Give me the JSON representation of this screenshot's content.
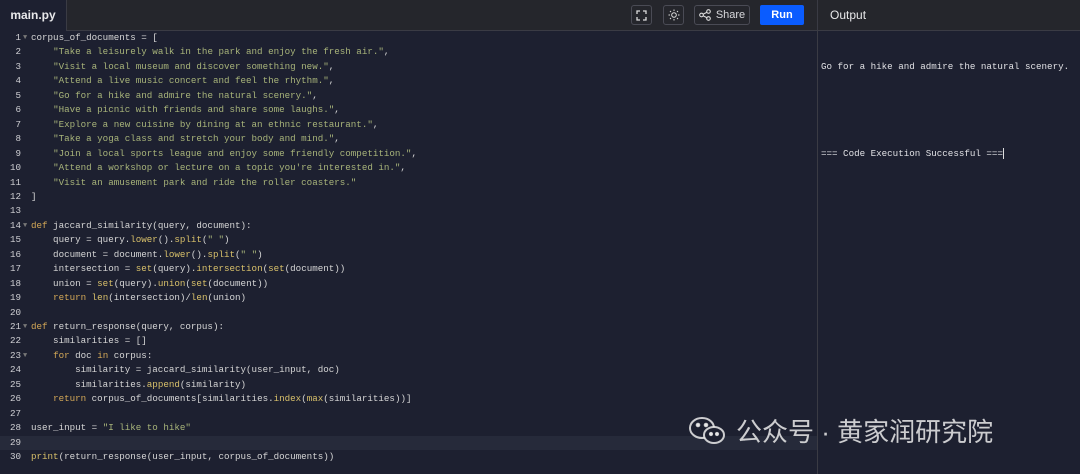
{
  "header": {
    "file_tab": "main.py",
    "share_label": "Share",
    "run_label": "Run",
    "output_title": "Output",
    "icons": [
      "fullscreen-icon",
      "theme-sun-icon",
      "share-icon"
    ]
  },
  "colors": {
    "run_button": "#0a5cff",
    "editor_bg": "#1d2030",
    "keyword": "#d4a857",
    "string": "#a8b47a"
  },
  "editor": {
    "active_line": 29,
    "fold_lines": [
      1,
      14,
      21,
      23
    ],
    "lines": [
      [
        [
          "t",
          "corpus_of_documents = ["
        ]
      ],
      [
        [
          "t",
          "    "
        ],
        [
          "str",
          "\"Take a leisurely walk in the park and enjoy the fresh air.\""
        ],
        [
          "t",
          ","
        ]
      ],
      [
        [
          "t",
          "    "
        ],
        [
          "str",
          "\"Visit a local museum and discover something new.\""
        ],
        [
          "t",
          ","
        ]
      ],
      [
        [
          "t",
          "    "
        ],
        [
          "str",
          "\"Attend a live music concert and feel the rhythm.\""
        ],
        [
          "t",
          ","
        ]
      ],
      [
        [
          "t",
          "    "
        ],
        [
          "str",
          "\"Go for a hike and admire the natural scenery.\""
        ],
        [
          "t",
          ","
        ]
      ],
      [
        [
          "t",
          "    "
        ],
        [
          "str",
          "\"Have a picnic with friends and share some laughs.\""
        ],
        [
          "t",
          ","
        ]
      ],
      [
        [
          "t",
          "    "
        ],
        [
          "str",
          "\"Explore a new cuisine by dining at an ethnic restaurant.\""
        ],
        [
          "t",
          ","
        ]
      ],
      [
        [
          "t",
          "    "
        ],
        [
          "str",
          "\"Take a yoga class and stretch your body and mind.\""
        ],
        [
          "t",
          ","
        ]
      ],
      [
        [
          "t",
          "    "
        ],
        [
          "str",
          "\"Join a local sports league and enjoy some friendly competition.\""
        ],
        [
          "t",
          ","
        ]
      ],
      [
        [
          "t",
          "    "
        ],
        [
          "str",
          "\"Attend a workshop or lecture on a topic you're interested in.\""
        ],
        [
          "t",
          ","
        ]
      ],
      [
        [
          "t",
          "    "
        ],
        [
          "str",
          "\"Visit an amusement park and ride the roller coasters.\""
        ]
      ],
      [
        [
          "t",
          "]"
        ]
      ],
      [],
      [
        [
          "kw",
          "def"
        ],
        [
          "t",
          " jaccard_similarity(query, document):"
        ]
      ],
      [
        [
          "t",
          "    query = query."
        ],
        [
          "fn",
          "lower"
        ],
        [
          "t",
          "()."
        ],
        [
          "fn",
          "split"
        ],
        [
          "t",
          "("
        ],
        [
          "str",
          "\" \""
        ],
        [
          "t",
          ")"
        ]
      ],
      [
        [
          "t",
          "    document = document."
        ],
        [
          "fn",
          "lower"
        ],
        [
          "t",
          "()."
        ],
        [
          "fn",
          "split"
        ],
        [
          "t",
          "("
        ],
        [
          "str",
          "\" \""
        ],
        [
          "t",
          ")"
        ]
      ],
      [
        [
          "t",
          "    intersection = "
        ],
        [
          "fn",
          "set"
        ],
        [
          "t",
          "(query)."
        ],
        [
          "fn",
          "intersection"
        ],
        [
          "t",
          "("
        ],
        [
          "fn",
          "set"
        ],
        [
          "t",
          "(document))"
        ]
      ],
      [
        [
          "t",
          "    union = "
        ],
        [
          "fn",
          "set"
        ],
        [
          "t",
          "(query)."
        ],
        [
          "fn",
          "union"
        ],
        [
          "t",
          "("
        ],
        [
          "fn",
          "set"
        ],
        [
          "t",
          "(document))"
        ]
      ],
      [
        [
          "t",
          "    "
        ],
        [
          "kw",
          "return"
        ],
        [
          "t",
          " "
        ],
        [
          "fn",
          "len"
        ],
        [
          "t",
          "(intersection)/"
        ],
        [
          "fn",
          "len"
        ],
        [
          "t",
          "(union)"
        ]
      ],
      [],
      [
        [
          "kw",
          "def"
        ],
        [
          "t",
          " return_response(query, corpus):"
        ]
      ],
      [
        [
          "t",
          "    similarities = []"
        ]
      ],
      [
        [
          "t",
          "    "
        ],
        [
          "kw",
          "for"
        ],
        [
          "t",
          " doc "
        ],
        [
          "kw",
          "in"
        ],
        [
          "t",
          " corpus:"
        ]
      ],
      [
        [
          "t",
          "        similarity = jaccard_similarity(user_input, doc)"
        ]
      ],
      [
        [
          "t",
          "        similarities."
        ],
        [
          "fn",
          "append"
        ],
        [
          "t",
          "(similarity)"
        ]
      ],
      [
        [
          "t",
          "    "
        ],
        [
          "kw",
          "return"
        ],
        [
          "t",
          " corpus_of_documents[similarities."
        ],
        [
          "fn",
          "index"
        ],
        [
          "t",
          "("
        ],
        [
          "fn",
          "max"
        ],
        [
          "t",
          "(similarities))]"
        ]
      ],
      [],
      [
        [
          "t",
          "user_input = "
        ],
        [
          "str",
          "\"I like to hike\""
        ]
      ],
      [],
      [
        [
          "fn",
          "print"
        ],
        [
          "t",
          "(return_response(user_input, corpus_of_documents))"
        ]
      ]
    ]
  },
  "output": {
    "lines": [
      "Go for a hike and admire the natural scenery.",
      "",
      "=== Code Execution Successful ==="
    ]
  },
  "watermark": {
    "text": "公众号 · 黄家润研究院",
    "icon": "wechat-icon"
  }
}
